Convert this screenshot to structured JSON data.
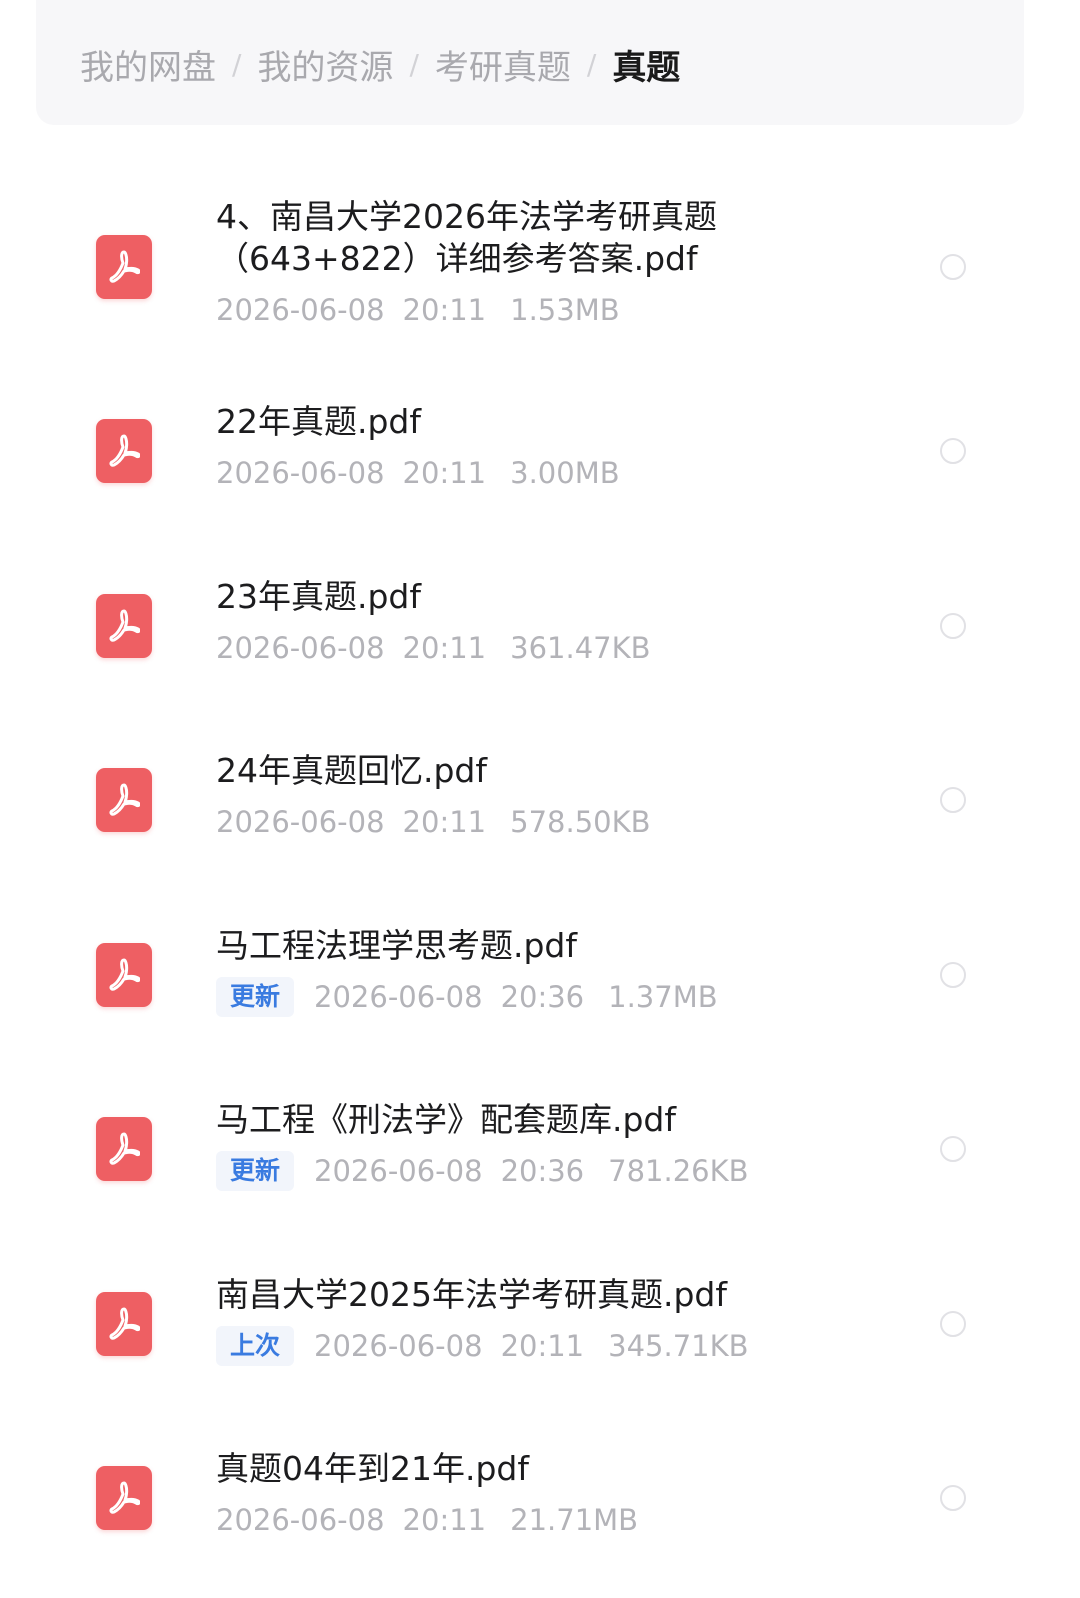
{
  "breadcrumb": {
    "items": [
      "我的网盘",
      "我的资源",
      "考研真题"
    ],
    "current": "真题",
    "separator": "/"
  },
  "files": [
    {
      "name_lines": [
        "4、南昌大学2026年法学考研真题",
        "（643+822）详细参考答案.pdf"
      ],
      "badge": "",
      "date": "2026-06-08",
      "time": "20:11",
      "size": "1.53MB",
      "icon": "pdf-icon"
    },
    {
      "name_lines": [
        "22年真题.pdf"
      ],
      "badge": "",
      "date": "2026-06-08",
      "time": "20:11",
      "size": "3.00MB",
      "icon": "pdf-icon"
    },
    {
      "name_lines": [
        "23年真题.pdf"
      ],
      "badge": "",
      "date": "2026-06-08",
      "time": "20:11",
      "size": "361.47KB",
      "icon": "pdf-icon"
    },
    {
      "name_lines": [
        "24年真题回忆.pdf"
      ],
      "badge": "",
      "date": "2026-06-08",
      "time": "20:11",
      "size": "578.50KB",
      "icon": "pdf-icon"
    },
    {
      "name_lines": [
        "马工程法理学思考题.pdf"
      ],
      "badge": "更新",
      "date": "2026-06-08",
      "time": "20:36",
      "size": "1.37MB",
      "icon": "pdf-icon"
    },
    {
      "name_lines": [
        "马工程《刑法学》配套题库.pdf"
      ],
      "badge": "更新",
      "date": "2026-06-08",
      "time": "20:36",
      "size": "781.26KB",
      "icon": "pdf-icon"
    },
    {
      "name_lines": [
        "南昌大学2025年法学考研真题.pdf"
      ],
      "badge": "上次",
      "date": "2026-06-08",
      "time": "20:11",
      "size": "345.71KB",
      "icon": "pdf-icon"
    },
    {
      "name_lines": [
        "真题04年到21年.pdf"
      ],
      "badge": "",
      "date": "2026-06-08",
      "time": "20:11",
      "size": "21.71MB",
      "icon": "pdf-icon"
    }
  ],
  "colors": {
    "pdf_red": "#ee5f63",
    "badge_blue": "#3a7be0",
    "meta_gray": "#b3b3b8"
  }
}
